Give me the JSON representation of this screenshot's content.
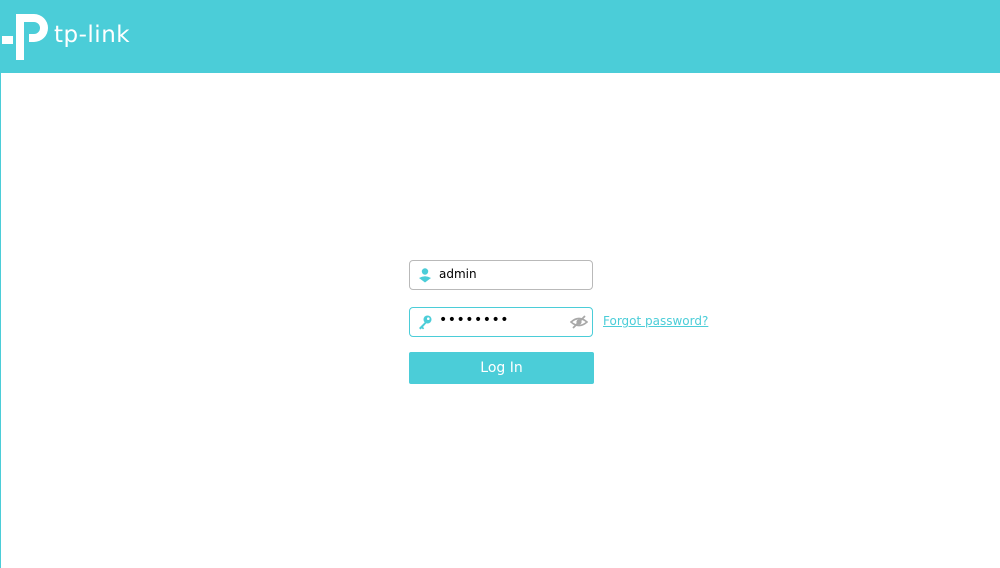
{
  "brand": {
    "logo_text": "tp-link",
    "color": "#4bcdd8"
  },
  "login": {
    "username_value": "admin",
    "password_mask": "••••••••",
    "forgot_label": "Forgot password?",
    "login_label": "Log In"
  },
  "icons": {
    "username": "user-icon",
    "password": "key-icon",
    "toggle": "eye-slash-icon"
  }
}
